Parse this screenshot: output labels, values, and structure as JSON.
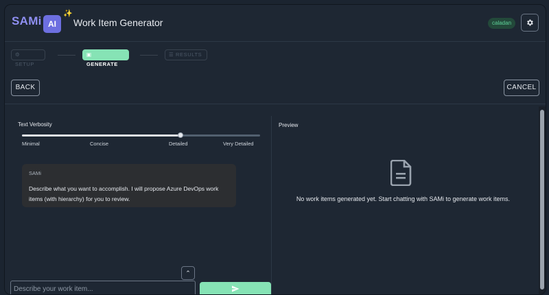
{
  "header": {
    "brand": "SAMi",
    "ai_badge": "AI",
    "sparkle_icon": "sparkle-icon",
    "title": "Work Item Generator",
    "user_badge": "caladan",
    "settings_icon": "gear-icon"
  },
  "stepper": {
    "steps": [
      {
        "label": "SETUP",
        "icon": "gear-icon",
        "state": "inactive"
      },
      {
        "label": "GENERATE",
        "icon": "chat-icon",
        "state": "active"
      },
      {
        "label": "RESULTS",
        "icon": "list-icon",
        "state": "inactive"
      }
    ]
  },
  "toolbar": {
    "back_label": "BACK",
    "cancel_label": "CANCEL"
  },
  "verbosity": {
    "label": "Text Verbosity",
    "options": [
      "Minimal",
      "Concise",
      "Detailed",
      "Very Detailed"
    ],
    "selected": "Detailed",
    "value_fraction": 0.667
  },
  "chat": {
    "messages": [
      {
        "sender": "SAMi",
        "text": "Describe what you want to accomplish. I will propose Azure DevOps work items (with hierarchy) for you to review."
      }
    ],
    "collapse_icon": "chevron-double-up-icon",
    "input_placeholder": "Describe your work item...",
    "input_value": "",
    "send_icon": "send-icon"
  },
  "preview": {
    "label": "Preview",
    "icon": "document-icon",
    "empty_text": "No work items generated yet. Start chatting with SAMi to generate work items."
  },
  "colors": {
    "accent": "#86e3b5",
    "brand": "#8f8ff2",
    "badge": "#6d6fe0",
    "background": "#1e2733"
  }
}
